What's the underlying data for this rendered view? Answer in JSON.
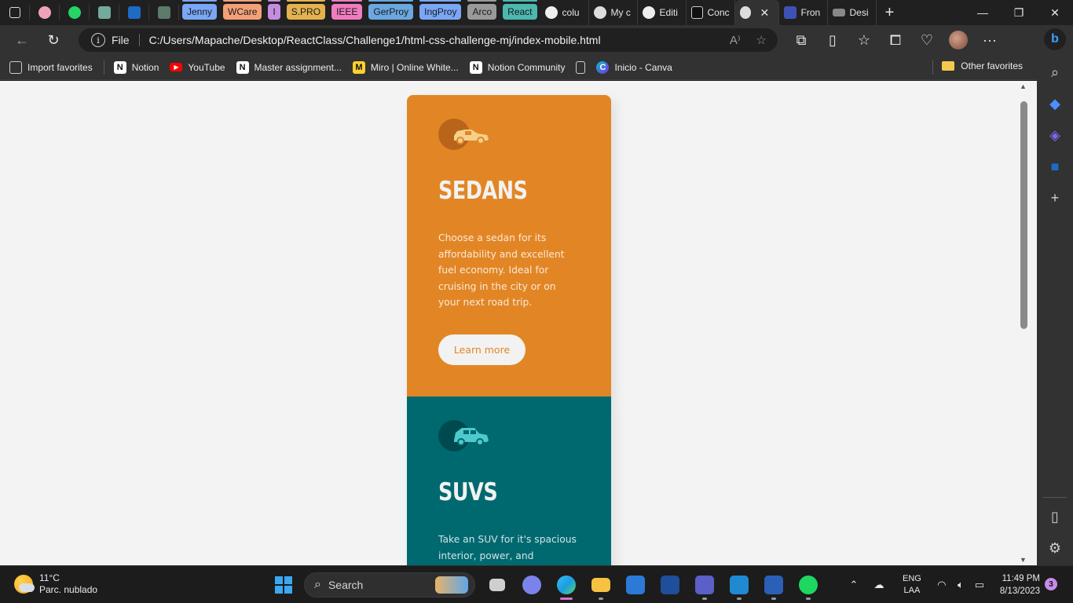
{
  "browser": {
    "tabs": [
      {
        "label": "Jenny",
        "color": "#7aa7f5"
      },
      {
        "label": "WCare",
        "color": "#f3a078"
      },
      {
        "label": "I",
        "color": "#c58de0"
      },
      {
        "label": "S.PRO",
        "color": "#e3b24f"
      },
      {
        "label": "IEEE",
        "color": "#f07bc0"
      },
      {
        "label": "GerProy",
        "color": "#6ba7e0"
      },
      {
        "label": "IngProy",
        "color": "#7aa7f5"
      },
      {
        "label": "Arco",
        "color": "#9a9a9a"
      },
      {
        "label": "React",
        "color": "#4cb8b0"
      }
    ],
    "open_tabs": [
      {
        "label": "colu"
      },
      {
        "label": "My c"
      },
      {
        "label": "Editi"
      },
      {
        "label": "Conc"
      },
      {
        "label": "Fron"
      },
      {
        "label": "Desi"
      }
    ],
    "address": {
      "scheme": "File",
      "url": "C:/Users/Mapache/Desktop/ReactClass/Challenge1/html-css-challenge-mj/index-mobile.html"
    },
    "favorites": [
      {
        "label": "Import favorites",
        "icon": "import-icon"
      },
      {
        "label": "Notion",
        "icon": "notion-icon"
      },
      {
        "label": "YouTube",
        "icon": "youtube-icon"
      },
      {
        "label": "Master assignment...",
        "icon": "notion-icon"
      },
      {
        "label": "Miro | Online White...",
        "icon": "miro-icon"
      },
      {
        "label": "Notion Community",
        "icon": "notion-icon"
      },
      {
        "label": "",
        "icon": "page-icon"
      },
      {
        "label": "Inicio - Canva",
        "icon": "canva-icon"
      }
    ],
    "other_favorites": "Other favorites"
  },
  "page": {
    "cards": [
      {
        "title": "SEDANS",
        "text": [
          "Choose a sedan for its",
          "affordability and excellent",
          "fuel economy. Ideal for",
          "cruising in the city or on",
          "your next road trip."
        ],
        "button": "Learn more",
        "color": "#e28625"
      },
      {
        "title": "SUVS",
        "text": [
          "Take an SUV for it's spacious",
          "interior, power, and"
        ],
        "color": "#006970"
      }
    ]
  },
  "taskbar": {
    "weather": {
      "temp": "11°C",
      "desc": "Parc. nublado"
    },
    "search_label": "Search",
    "lang": {
      "code": "ENG",
      "layout": "LAA"
    },
    "clock": {
      "time": "11:49 PM",
      "date": "8/13/2023"
    },
    "notifications": "3"
  }
}
